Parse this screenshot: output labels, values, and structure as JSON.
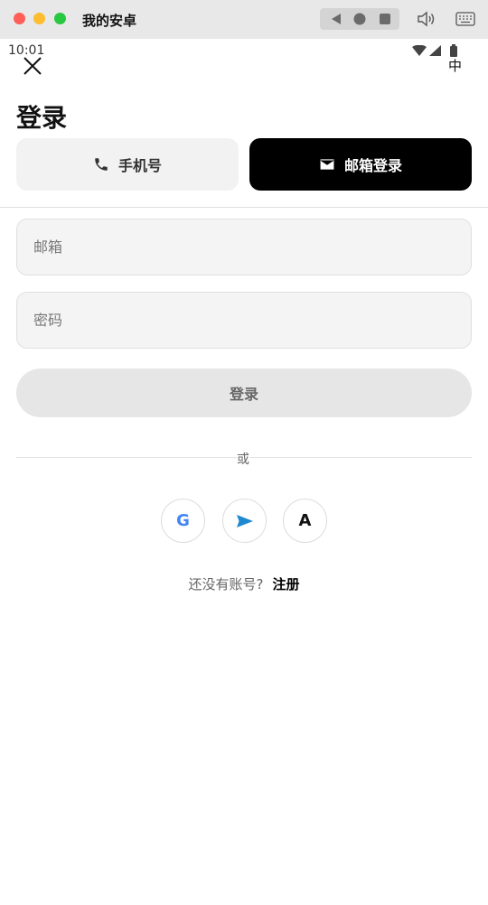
{
  "window": {
    "title": "我的安卓"
  },
  "status_bar": {
    "time": "10:01",
    "ime": "中"
  },
  "page": {
    "title": "登录"
  },
  "tabs": [
    {
      "label": "手机号",
      "icon": "phone-icon",
      "active": false
    },
    {
      "label": "邮箱登录",
      "icon": "mail-icon",
      "active": true
    }
  ],
  "form": {
    "email_placeholder": "邮箱",
    "email_value": "",
    "password_placeholder": "密码",
    "password_value": "",
    "submit_label": "登录"
  },
  "separator": {
    "label": "或"
  },
  "social": [
    {
      "label": "G",
      "icon": "google-icon"
    },
    {
      "label": "",
      "icon": "telegram-icon"
    },
    {
      "label": "A",
      "icon": "apple-icon"
    }
  ],
  "signup": {
    "question": "还没有账号?",
    "link": "注册"
  },
  "colors": {
    "active_tab_bg": "#000000",
    "inactive_tab_bg": "#f2f2f2",
    "google_blue": "#4285f4",
    "telegram_blue": "#1e88d0"
  }
}
